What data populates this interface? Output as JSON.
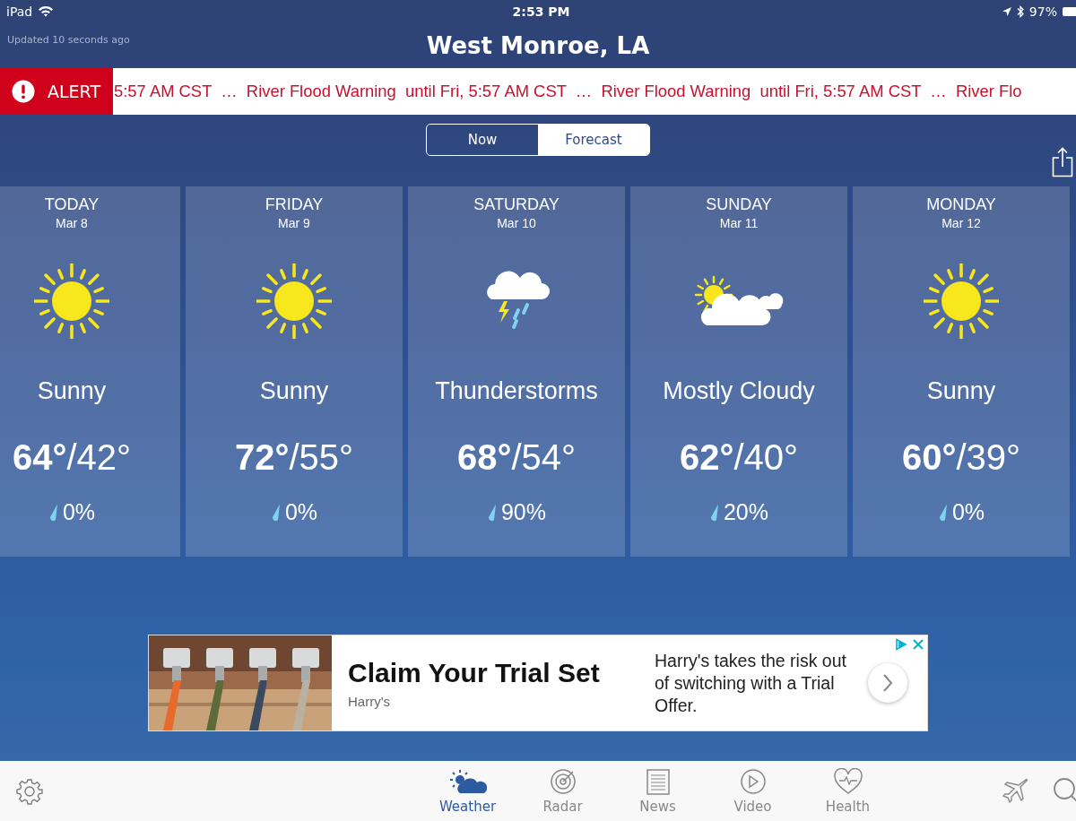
{
  "status_bar": {
    "device": "iPad",
    "time": "2:53 PM",
    "battery": "97%"
  },
  "header": {
    "updated": "Updated 10 seconds ago",
    "title": "West Monroe, LA"
  },
  "alert": {
    "label": "ALERT",
    "text": "5:57 AM CST  …  River Flood Warning  until Fri, 5:57 AM CST  …  River Flood Warning  until Fri, 5:57 AM CST  …  River Flo"
  },
  "segments": [
    {
      "label": "Now",
      "selected": false
    },
    {
      "label": "Forecast",
      "selected": true
    }
  ],
  "days": [
    {
      "day": "TODAY",
      "date": "Mar 8",
      "kind": "sunny",
      "condition": "Sunny",
      "temps": "**64°**/42°",
      "precip": "0%"
    },
    {
      "day": "FRIDAY",
      "date": "Mar 9",
      "kind": "sunny",
      "condition": "Sunny",
      "temps": "**72°**/55°",
      "precip": "0%"
    },
    {
      "day": "SATURDAY",
      "date": "Mar 10",
      "kind": "storm",
      "condition": "Thunderstorms",
      "temps": "**68°**/54°",
      "precip": "90%"
    },
    {
      "day": "SUNDAY",
      "date": "Mar 11",
      "kind": "cloudy",
      "condition": "Mostly Cloudy",
      "temps": "**62°**/40°",
      "precip": "20%"
    },
    {
      "day": "MONDAY",
      "date": "Mar 12",
      "kind": "sunny",
      "condition": "Sunny",
      "temps": "**60°**/39°",
      "precip": "0%"
    }
  ],
  "ad": {
    "kind": "picture",
    "title": "Claim Your Trial Set",
    "brand": "Harry's",
    "body": "Harry's takes the risk out of switching with a Trial Offer."
  },
  "tabs": [
    {
      "label": "Weather",
      "kind": "weather",
      "selected": true
    },
    {
      "label": "Radar",
      "kind": "radar",
      "selected": false
    },
    {
      "label": "News",
      "kind": "news",
      "selected": false
    },
    {
      "label": "Video",
      "kind": "video",
      "selected": false
    },
    {
      "label": "Health",
      "kind": "health",
      "selected": false
    }
  ]
}
